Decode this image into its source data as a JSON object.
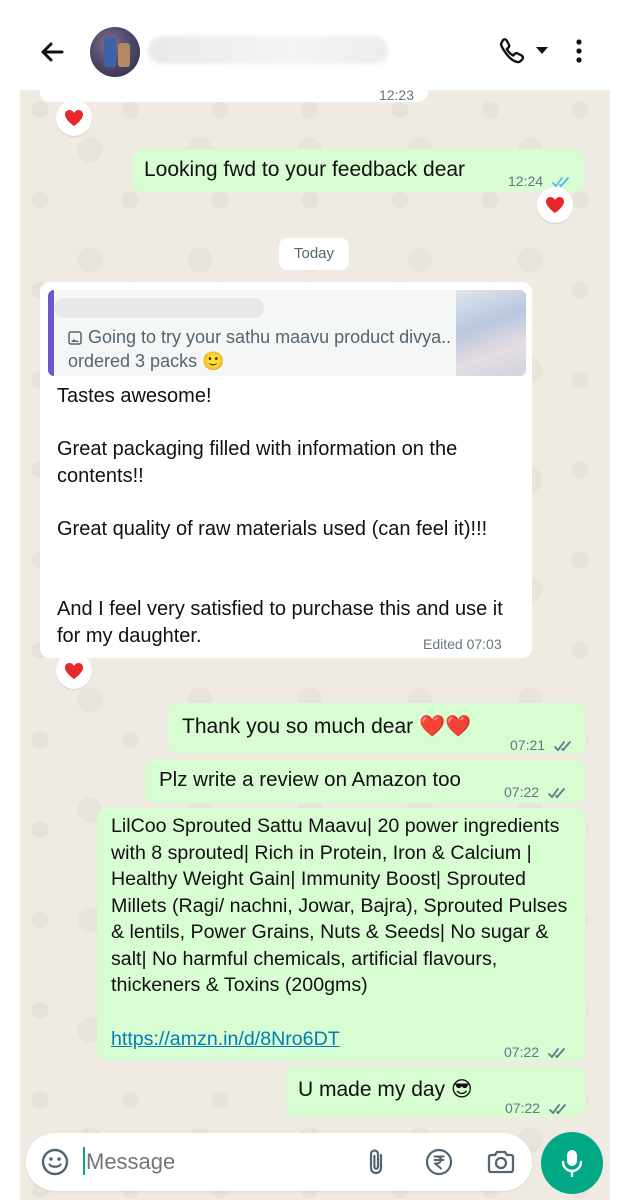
{
  "header": {
    "contact_name": "",
    "back_icon": "arrow-left-icon",
    "call_icon": "phone-icon",
    "menu_icon": "more-vertical-icon"
  },
  "messages": {
    "prev_time": "12:23",
    "m1": {
      "text": "Looking fwd to your feedback dear",
      "time": "12:24"
    },
    "day_label": "Today",
    "incoming": {
      "quote": "Going to try your sathu maavu product divya.. ordered 3 packs 🙂",
      "p1": "Tastes awesome!",
      "p2": "Great packaging filled with information on the contents!!",
      "p3": "Great quality of raw materials used (can feel it)!!!",
      "p4": "And I feel very satisfied to purchase this and use it for my daughter.",
      "time": "Edited 07:03"
    },
    "m2": {
      "text": "Thank you so much dear ❤️❤️",
      "time": "07:21"
    },
    "m3": {
      "text": "Plz write a review on Amazon too",
      "time": "07:22"
    },
    "m4": {
      "text": "LilCoo Sprouted Sattu Maavu| 20 power ingredients with 8 sprouted| Rich in Protein, Iron & Calcium | Healthy Weight Gain| Immunity Boost| Sprouted Millets (Ragi/ nachni, Jowar, Bajra), Sprouted Pulses & lentils, Power Grains, Nuts & Seeds| No sugar & salt| No harmful chemicals, artificial flavours, thickeners & Toxins (200gms)",
      "link": "https://amzn.in/d/8Nro6DT",
      "time": "07:22"
    },
    "m5": {
      "text": "U made my day 😎",
      "time": "07:22"
    }
  },
  "reactions": {
    "emoji": "heart"
  },
  "input": {
    "placeholder": "Message",
    "icons": [
      "sticker-icon",
      "attach-icon",
      "rupee-payment-icon",
      "camera-icon",
      "mic-icon"
    ]
  },
  "colors": {
    "outgoing_bubble": "#d9fdd3",
    "incoming_bubble": "#ffffff",
    "chat_bg": "#efeae2",
    "accent": "#00a884",
    "read_tick_blue": "#53bdeb",
    "link": "#027eb5",
    "quote_bar": "#6e56cf"
  }
}
